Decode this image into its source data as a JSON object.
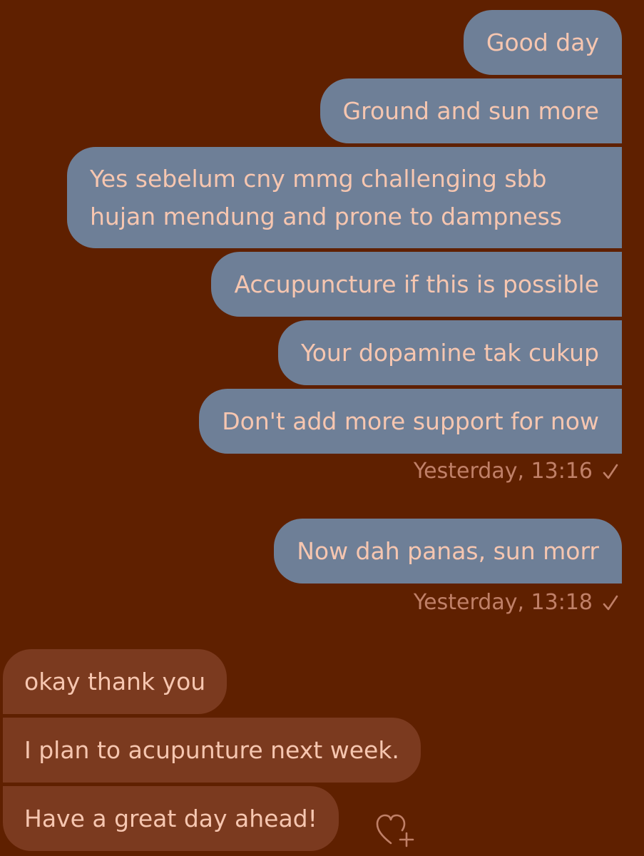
{
  "conversation": {
    "outgoing_group_1": [
      {
        "text": "Good day"
      },
      {
        "text": "Ground and sun more"
      },
      {
        "text": "Yes sebelum cny mmg challenging sbb hujan mendung and prone to dampness"
      },
      {
        "text": "Accupuncture if this is possible"
      },
      {
        "text": "Your dopamine tak cukup"
      },
      {
        "text": "Don't add more support for now"
      }
    ],
    "outgoing_group_1_timestamp": "Yesterday, 13:16",
    "outgoing_group_2": [
      {
        "text": "Now dah panas, sun morr"
      }
    ],
    "outgoing_group_2_timestamp": "Yesterday, 13:18",
    "incoming_group": [
      {
        "text": "okay thank you"
      },
      {
        "text": "I plan to acupunture next week."
      },
      {
        "text": "Have a great day ahead!"
      }
    ]
  },
  "icons": {
    "read_status": "check-icon",
    "add_reaction": "heart-plus-icon"
  },
  "colors": {
    "background": "#5f2000",
    "outgoing_bubble": "#6e7f97",
    "incoming_bubble": "#7b3a1f",
    "bubble_text": "#f6c6b0",
    "meta_text": "#c08068"
  }
}
